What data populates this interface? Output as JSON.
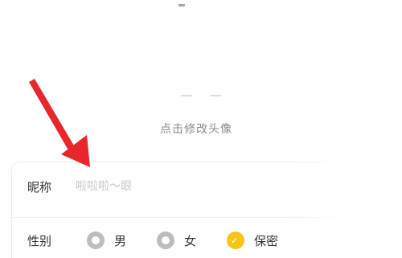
{
  "avatar": {
    "hint": "点击修改头像"
  },
  "profile": {
    "nickname": {
      "label": "昵称",
      "value": "",
      "placeholder": "啦啦啦～眼"
    },
    "gender": {
      "label": "性别",
      "options": [
        {
          "label": "男",
          "icon": "radio-circle-icon",
          "selected": false
        },
        {
          "label": "女",
          "icon": "radio-circle-icon",
          "selected": false
        },
        {
          "label": "保密",
          "icon": "radio-selected-icon",
          "selected": true
        }
      ]
    }
  },
  "colors": {
    "annotation_arrow": "#e8262c",
    "selected_radio": "#f5c518",
    "unselected_radio": "#bdbdbd"
  }
}
